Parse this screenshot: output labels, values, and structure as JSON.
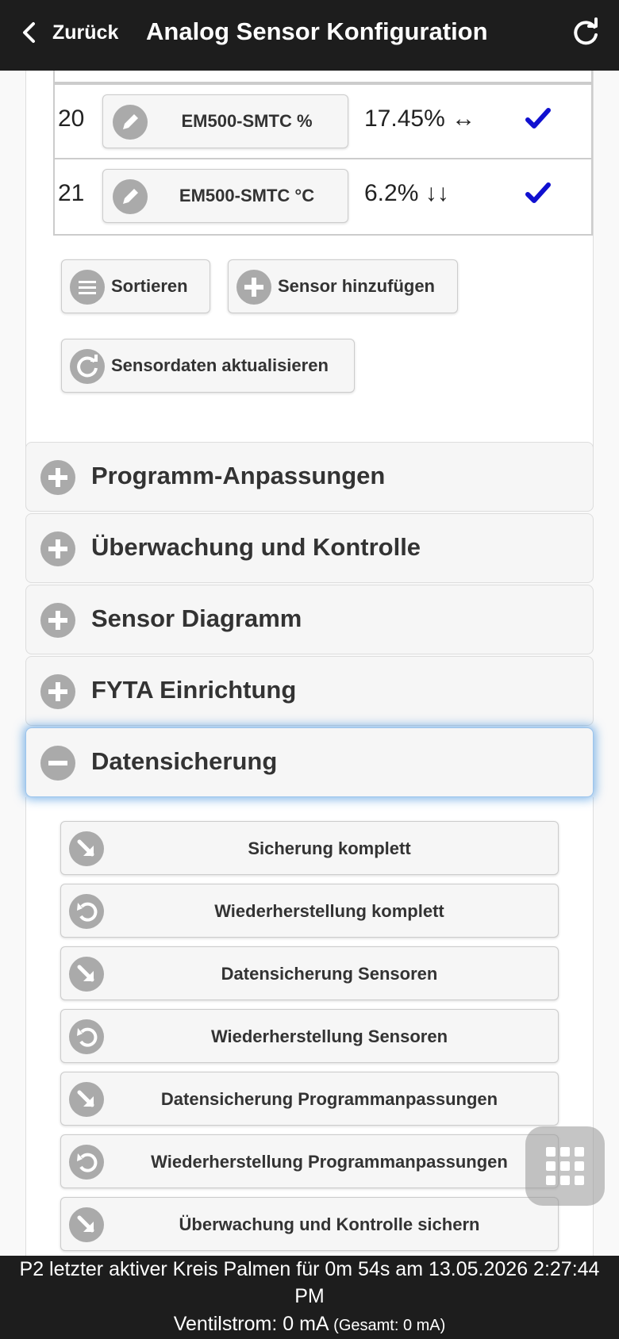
{
  "header": {
    "back_label": "Zurück",
    "title": "Analog Sensor Konfiguration"
  },
  "sensors": {
    "rows": [
      {
        "num": "20",
        "name": "EM500-SMTC %",
        "value": "17.45% ↔"
      },
      {
        "num": "21",
        "name": "EM500-SMTC °C",
        "value": "6.2% ↓↓"
      }
    ],
    "check_color": "#1010d0"
  },
  "actions": {
    "sort_label": "Sortieren",
    "add_label": "Sensor hinzufügen",
    "refresh_label": "Sensordaten aktualisieren"
  },
  "sections": {
    "program": "Programm-Anpassungen",
    "monitoring": "Überwachung und Kontrolle",
    "diagram": "Sensor Diagramm",
    "fyta": "FYTA Einrichtung",
    "backup": "Datensicherung"
  },
  "backup_buttons": [
    {
      "label": "Sicherung komplett",
      "icon": "download-arrow-icon"
    },
    {
      "label": "Wiederherstellung komplett",
      "icon": "restore-icon"
    },
    {
      "label": "Datensicherung Sensoren",
      "icon": "download-arrow-icon"
    },
    {
      "label": "Wiederherstellung Sensoren",
      "icon": "restore-icon"
    },
    {
      "label": "Datensicherung Programmanpassungen",
      "icon": "download-arrow-icon"
    },
    {
      "label": "Wiederherstellung Programmanpassungen",
      "icon": "restore-icon"
    },
    {
      "label": "Überwachung und Kontrolle sichern",
      "icon": "download-arrow-icon"
    }
  ],
  "footer": {
    "status_line": "P2 letzter aktiver Kreis Palmen für 0m 54s am 13.05.2026 2:27:44 PM",
    "current_label": "Ventilstrom: 0 mA",
    "total_label": "(Gesamt: 0 mA)"
  },
  "colors": {
    "header_bg": "#1d1d1d",
    "accent_glow": "#388cdc"
  }
}
